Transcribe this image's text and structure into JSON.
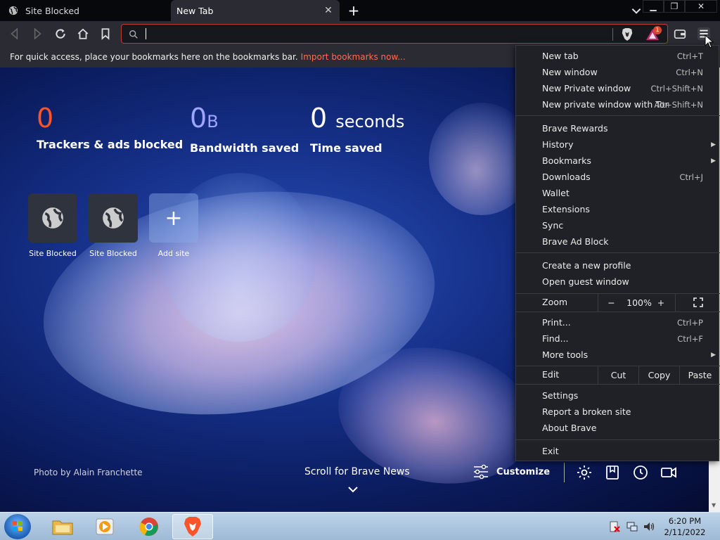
{
  "tabs": [
    {
      "title": "Site Blocked",
      "active": false
    },
    {
      "title": "New Tab",
      "active": true
    }
  ],
  "address_bar": {
    "value": "",
    "placeholder": ""
  },
  "rewards_badge": "1",
  "bookmarks_bar": {
    "message": "For quick access, place your bookmarks here on the bookmarks bar.",
    "link": "Import bookmarks now..."
  },
  "stats": [
    {
      "value": "0",
      "unit": "",
      "label": "Trackers & ads blocked",
      "color": "#fb542b"
    },
    {
      "value": "0",
      "unit": "B",
      "label": "Bandwidth saved",
      "color": "#a0a5ff"
    },
    {
      "value": "0",
      "unit": "seconds",
      "label": "Time saved",
      "color": "#ffffff"
    }
  ],
  "top_sites": [
    {
      "label": "Site Blocked"
    },
    {
      "label": "Site Blocked"
    },
    {
      "label": "Add site"
    }
  ],
  "footer": {
    "photo_credit": "Photo by Alain Franchette",
    "scroll_news": "Scroll for Brave News",
    "customize": "Customize"
  },
  "menu": {
    "group1": [
      {
        "label": "New tab",
        "shortcut": "Ctrl+T"
      },
      {
        "label": "New window",
        "shortcut": "Ctrl+N"
      },
      {
        "label": "New Private window",
        "shortcut": "Ctrl+Shift+N"
      },
      {
        "label": "New private window with Tor",
        "shortcut": "Alt+Shift+N"
      }
    ],
    "group2": [
      {
        "label": "Brave Rewards",
        "shortcut": "",
        "submenu": false
      },
      {
        "label": "History",
        "shortcut": "",
        "submenu": true
      },
      {
        "label": "Bookmarks",
        "shortcut": "",
        "submenu": true
      },
      {
        "label": "Downloads",
        "shortcut": "Ctrl+J",
        "submenu": false
      },
      {
        "label": "Wallet",
        "shortcut": "",
        "submenu": false
      },
      {
        "label": "Extensions",
        "shortcut": "",
        "submenu": false
      },
      {
        "label": "Sync",
        "shortcut": "",
        "submenu": false
      },
      {
        "label": "Brave Ad Block",
        "shortcut": "",
        "submenu": false
      }
    ],
    "group3": [
      {
        "label": "Create a new profile"
      },
      {
        "label": "Open guest window"
      }
    ],
    "zoom": {
      "label": "Zoom",
      "minus": "−",
      "value": "100%",
      "plus": "+"
    },
    "group4": [
      {
        "label": "Print...",
        "shortcut": "Ctrl+P",
        "submenu": false
      },
      {
        "label": "Find...",
        "shortcut": "Ctrl+F",
        "submenu": false
      },
      {
        "label": "More tools",
        "shortcut": "",
        "submenu": true
      }
    ],
    "edit": {
      "label": "Edit",
      "cut": "Cut",
      "copy": "Copy",
      "paste": "Paste"
    },
    "group5": [
      {
        "label": "Settings"
      },
      {
        "label": "Report a broken site"
      },
      {
        "label": "About Brave"
      }
    ],
    "exit": "Exit"
  },
  "taskbar": {
    "time": "6:20 PM",
    "date": "2/11/2022"
  }
}
